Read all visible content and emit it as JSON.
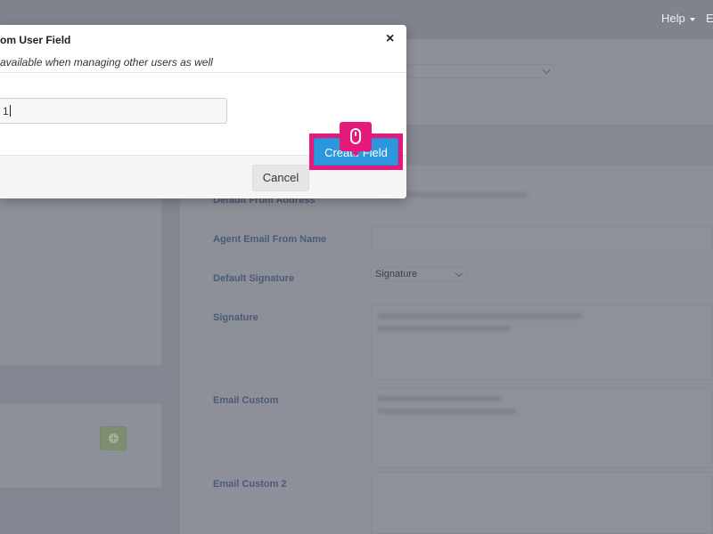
{
  "nav": {
    "help_label": "Help",
    "truncated_label": "E"
  },
  "form": {
    "default_from_address_label": "Default From Address",
    "agent_email_from_name_label": "Agent Email From Name",
    "default_signature_label": "Default Signature",
    "default_signature_value": "Signature",
    "signature_label": "Signature",
    "email_custom_label": "Email Custom",
    "email_custom_2_label": "Email Custom 2"
  },
  "modal": {
    "title": "om User Field",
    "subtitle": "available when managing other users as well",
    "input_value": "1",
    "cancel_label": "Cancel",
    "create_label": "Create Field"
  },
  "colors": {
    "accent_highlight": "#e5197a",
    "primary_button": "#2c97dd"
  },
  "icons": {
    "close": "close-icon",
    "click_indicator": "mouse-icon",
    "add": "plus-circle-icon"
  }
}
